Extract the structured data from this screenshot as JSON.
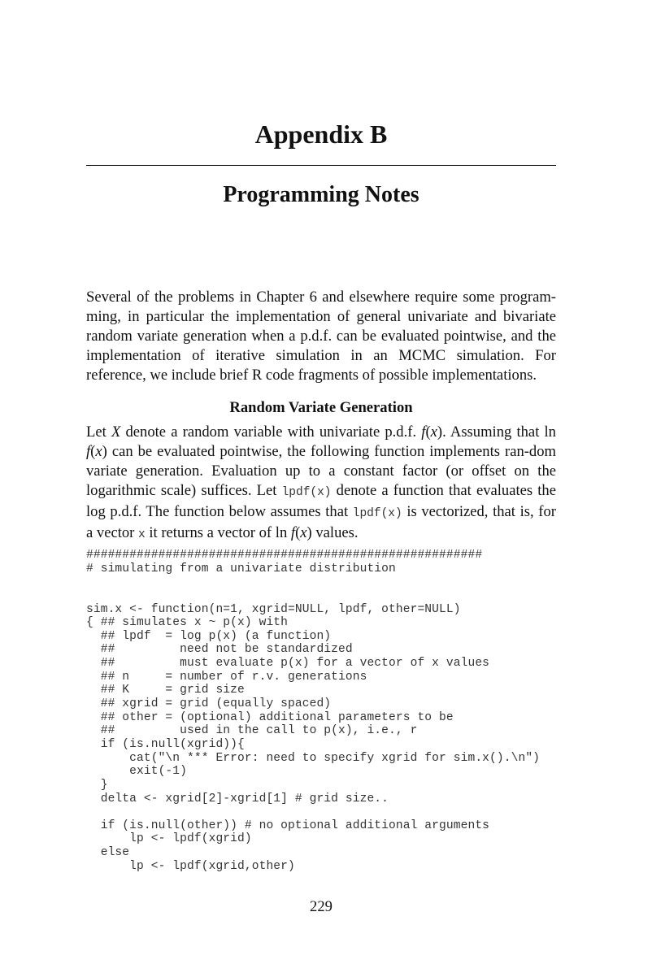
{
  "chapter": {
    "title": "Appendix B",
    "subtitle": "Programming Notes"
  },
  "intro": {
    "lines": [
      "Several of the problems in Chapter 6 and elsewhere require some program-",
      "ming, in particular the implementation of general univariate and bivariate",
      "random variate generation when a p.d.f. can be evaluated pointwise, and",
      "the implementation of iterative simulation in an MCMC simulation. For",
      "reference, we include brief R code fragments of possible implementations."
    ]
  },
  "section": {
    "heading": "Random Variate Generation",
    "para": {
      "s1": "Let ",
      "X": "X",
      "s2": " denote a random variable with univariate p.d.f. ",
      "f1": "f",
      "s3": "(",
      "x1": "x",
      "s4": "). Assuming that ln ",
      "f2": "f",
      "s5": "(",
      "x2": "x",
      "s6": ") can be evaluated pointwise, the following function implements ran-dom variate generation. Evaluation up to a constant factor (or offset on the logarithmic scale) suffices. Let ",
      "code1": "lpdf(x)",
      "s7": " denote a function that evaluates the log p.d.f. The function below assumes that ",
      "code2": "lpdf(x)",
      "s8": " is vectorized, that is, for a vector ",
      "code3": "x",
      "s9": " it returns a vector of ln ",
      "f3": "f",
      "s10": "(",
      "x3": "x",
      "s11": ") values."
    }
  },
  "code": {
    "language": "R",
    "lines": [
      "#######################################################",
      "# simulating from a univariate distribution",
      "",
      "",
      "sim.x <- function(n=1, xgrid=NULL, lpdf, other=NULL)",
      "{ ## simulates x ~ p(x) with",
      "  ## lpdf  = log p(x) (a function)",
      "  ##         need not be standardized",
      "  ##         must evaluate p(x) for a vector of x values",
      "  ## n     = number of r.v. generations",
      "  ## K     = grid size",
      "  ## xgrid = grid (equally spaced)",
      "  ## other = (optional) additional parameters to be",
      "  ##         used in the call to p(x), i.e., r",
      "  if (is.null(xgrid)){",
      "      cat(\"\\n *** Error: need to specify xgrid for sim.x().\\n\")",
      "      exit(-1)",
      "  }",
      "  delta <- xgrid[2]-xgrid[1] # grid size..",
      "",
      "  if (is.null(other)) # no optional additional arguments",
      "      lp <- lpdf(xgrid)",
      "  else",
      "      lp <- lpdf(xgrid,other)"
    ]
  },
  "footer": {
    "page_number": "229"
  }
}
